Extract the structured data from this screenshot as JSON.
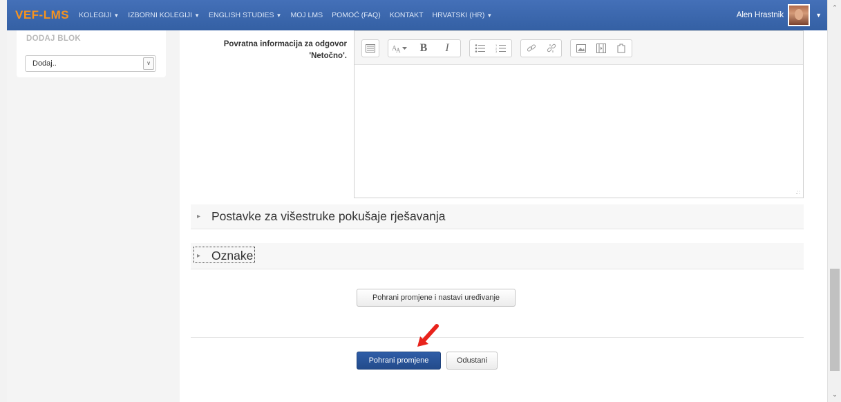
{
  "navbar": {
    "brand": "VEF-LMS",
    "items": [
      {
        "label": "KOLEGIJI",
        "caret": "▼"
      },
      {
        "label": "IZBORNI KOLEGIJI",
        "caret": "▼"
      },
      {
        "label": "ENGLISH STUDIES",
        "caret": "▼"
      },
      {
        "label": "MOJ LMS",
        "caret": ""
      },
      {
        "label": "POMOĆ (FAQ)",
        "caret": ""
      },
      {
        "label": "KONTAKT",
        "caret": ""
      },
      {
        "label": "HRVATSKI (HR)",
        "caret": "▼"
      }
    ],
    "user_name": "Alen Hrastnik",
    "user_caret": "▼"
  },
  "sidebar": {
    "block_title": "DODAJ BLOK",
    "select_value": "Dodaj.."
  },
  "form": {
    "feedback_label_line1": "Povratna informacija za odgovor",
    "feedback_label_line2": "'Netočno'."
  },
  "sections": {
    "multiple_tries": "Postavke za višestruke pokušaje rješavanja",
    "tags": "Oznake",
    "collapsed_icon": "triangle-right-icon"
  },
  "buttons": {
    "save_continue": "Pohrani promjene i nastavi uređivanje",
    "save": "Pohrani promjene",
    "cancel": "Odustani"
  },
  "colors": {
    "navbar": "#3a64a8",
    "brand": "#f7931e",
    "primary_button": "#2a559c",
    "annotation_arrow": "#e8231c"
  }
}
